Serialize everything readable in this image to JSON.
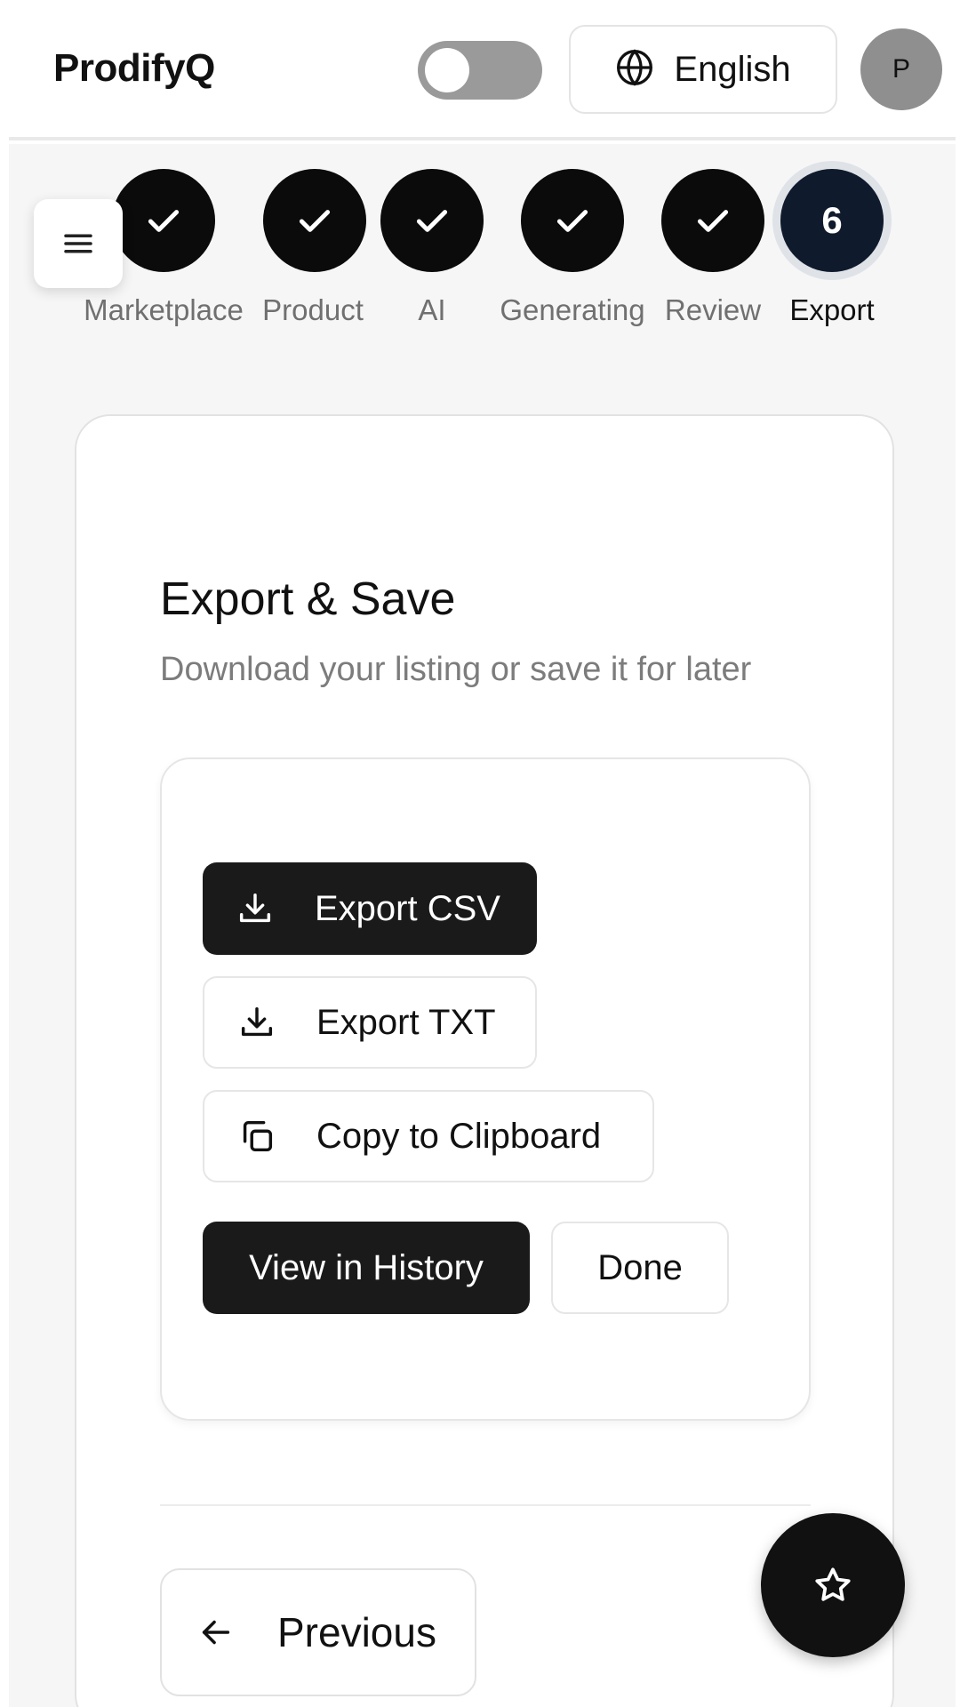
{
  "header": {
    "brand": "ProdifyQ",
    "theme_toggle_on": false,
    "language": "English",
    "avatar_initial": "P"
  },
  "stepper": {
    "steps": [
      {
        "label": "Marketplace",
        "status": "complete",
        "icon": "check-icon"
      },
      {
        "label": "Product",
        "status": "complete",
        "icon": "check-icon"
      },
      {
        "label": "AI",
        "status": "complete",
        "icon": "check-icon"
      },
      {
        "label": "Generating",
        "status": "complete",
        "icon": "check-icon"
      },
      {
        "label": "Review",
        "status": "complete",
        "icon": "check-icon"
      },
      {
        "label": "Export",
        "status": "active",
        "number": "6"
      }
    ]
  },
  "export": {
    "title": "Export & Save",
    "subtitle": "Download your listing or save it for later",
    "actions": {
      "csv": {
        "label": "Export CSV",
        "icon": "download-icon"
      },
      "txt": {
        "label": "Export TXT",
        "icon": "download-icon"
      },
      "copy": {
        "label": "Copy to Clipboard",
        "icon": "copy-icon"
      },
      "history": {
        "label": "View in History"
      },
      "done": {
        "label": "Done"
      }
    }
  },
  "nav": {
    "previous_label": "Previous",
    "previous_icon": "arrow-left-icon"
  },
  "fab": {
    "icon": "star-icon"
  },
  "colors": {
    "primary": "#1a1a1a",
    "active_step": "#0f1b2d",
    "muted_text": "#7c7c7c"
  }
}
